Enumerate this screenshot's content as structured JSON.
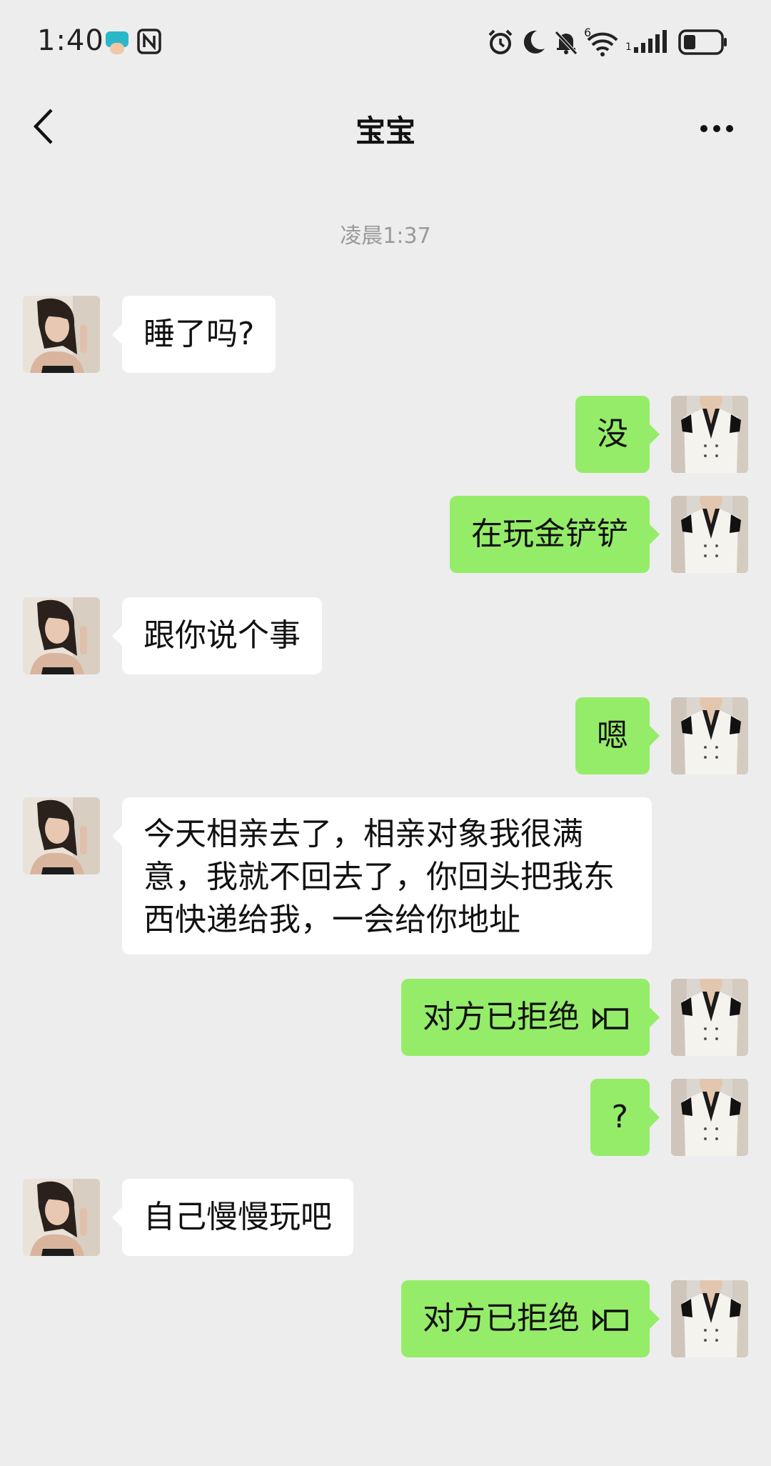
{
  "status_bar": {
    "time": "1:40",
    "icons": [
      "app-notification-icon",
      "nfc-icon",
      "alarm-icon",
      "moon-icon",
      "mute-icon",
      "wifi-icon",
      "signal-icon",
      "battery-icon"
    ],
    "wifi_label": "6"
  },
  "header": {
    "title": "宝宝",
    "back_icon": "chevron-left-icon",
    "more_icon": "more-dots-icon"
  },
  "timestamp": "凌晨1:37",
  "colors": {
    "background": "#ededed",
    "incoming_bubble": "#ffffff",
    "outgoing_bubble": "#95ec69"
  },
  "messages": [
    {
      "side": "in",
      "text": "睡了吗?"
    },
    {
      "side": "out",
      "text": "没"
    },
    {
      "side": "out",
      "text": "在玩金铲铲"
    },
    {
      "side": "in",
      "text": "跟你说个事"
    },
    {
      "side": "out",
      "text": "嗯"
    },
    {
      "side": "in",
      "text": "今天相亲去了，相亲对象我很满意，我就不回去了，你回头把我东西快递给我，一会给你地址"
    },
    {
      "side": "out",
      "text": "对方已拒绝",
      "icon": "video-call-icon"
    },
    {
      "side": "out",
      "text": "?"
    },
    {
      "side": "in",
      "text": "自己慢慢玩吧"
    },
    {
      "side": "out",
      "text": "对方已拒绝",
      "icon": "video-call-icon"
    }
  ]
}
